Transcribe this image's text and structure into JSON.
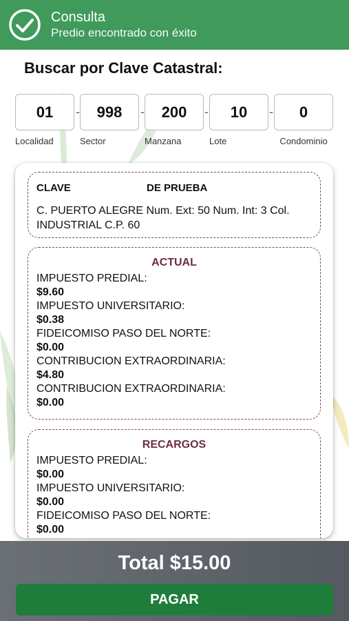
{
  "toast": {
    "title": "Consulta",
    "message": "Predio encontrado con éxito",
    "icon": "check-circle-icon",
    "color": "#3f9a5b"
  },
  "search": {
    "heading": "Buscar por Clave Catastral:",
    "fields": [
      {
        "value": "01",
        "label": "Localidad"
      },
      {
        "value": "998",
        "label": "Sector"
      },
      {
        "value": "200",
        "label": "Manzana"
      },
      {
        "value": "10",
        "label": "Lote"
      },
      {
        "value": "0",
        "label": "Condominio"
      }
    ],
    "separator": "-"
  },
  "property": {
    "clave_label": "CLAVE",
    "clave_value": "DE PRUEBA",
    "address": "C. PUERTO ALEGRE Num. Ext: 50 Num. Int: 3 Col. INDUSTRIAL C.P. 60"
  },
  "actual": {
    "title": "ACTUAL",
    "items": [
      {
        "name": "IMPUESTO PREDIAL:",
        "amount": "$9.60"
      },
      {
        "name": "IMPUESTO UNIVERSITARIO:",
        "amount": "$0.38"
      },
      {
        "name": "FIDEICOMISO PASO DEL NORTE:",
        "amount": "$0.00"
      },
      {
        "name": "CONTRIBUCION EXTRAORDINARIA:",
        "amount": "$4.80"
      },
      {
        "name": "CONTRIBUCION EXTRAORDINARIA:",
        "amount": "$0.00"
      }
    ]
  },
  "recargos": {
    "title": "RECARGOS",
    "items": [
      {
        "name": "IMPUESTO PREDIAL:",
        "amount": "$0.00"
      },
      {
        "name": "IMPUESTO UNIVERSITARIO:",
        "amount": "$0.00"
      },
      {
        "name": "FIDEICOMISO PASO DEL NORTE:",
        "amount": "$0.00"
      }
    ]
  },
  "footer": {
    "total": "Total $15.00",
    "pay_label": "PAGAR",
    "pay_color": "#1f7d3b"
  },
  "colors": {
    "accent": "#6e2c45",
    "dashed_border": "#7b4a5d"
  }
}
